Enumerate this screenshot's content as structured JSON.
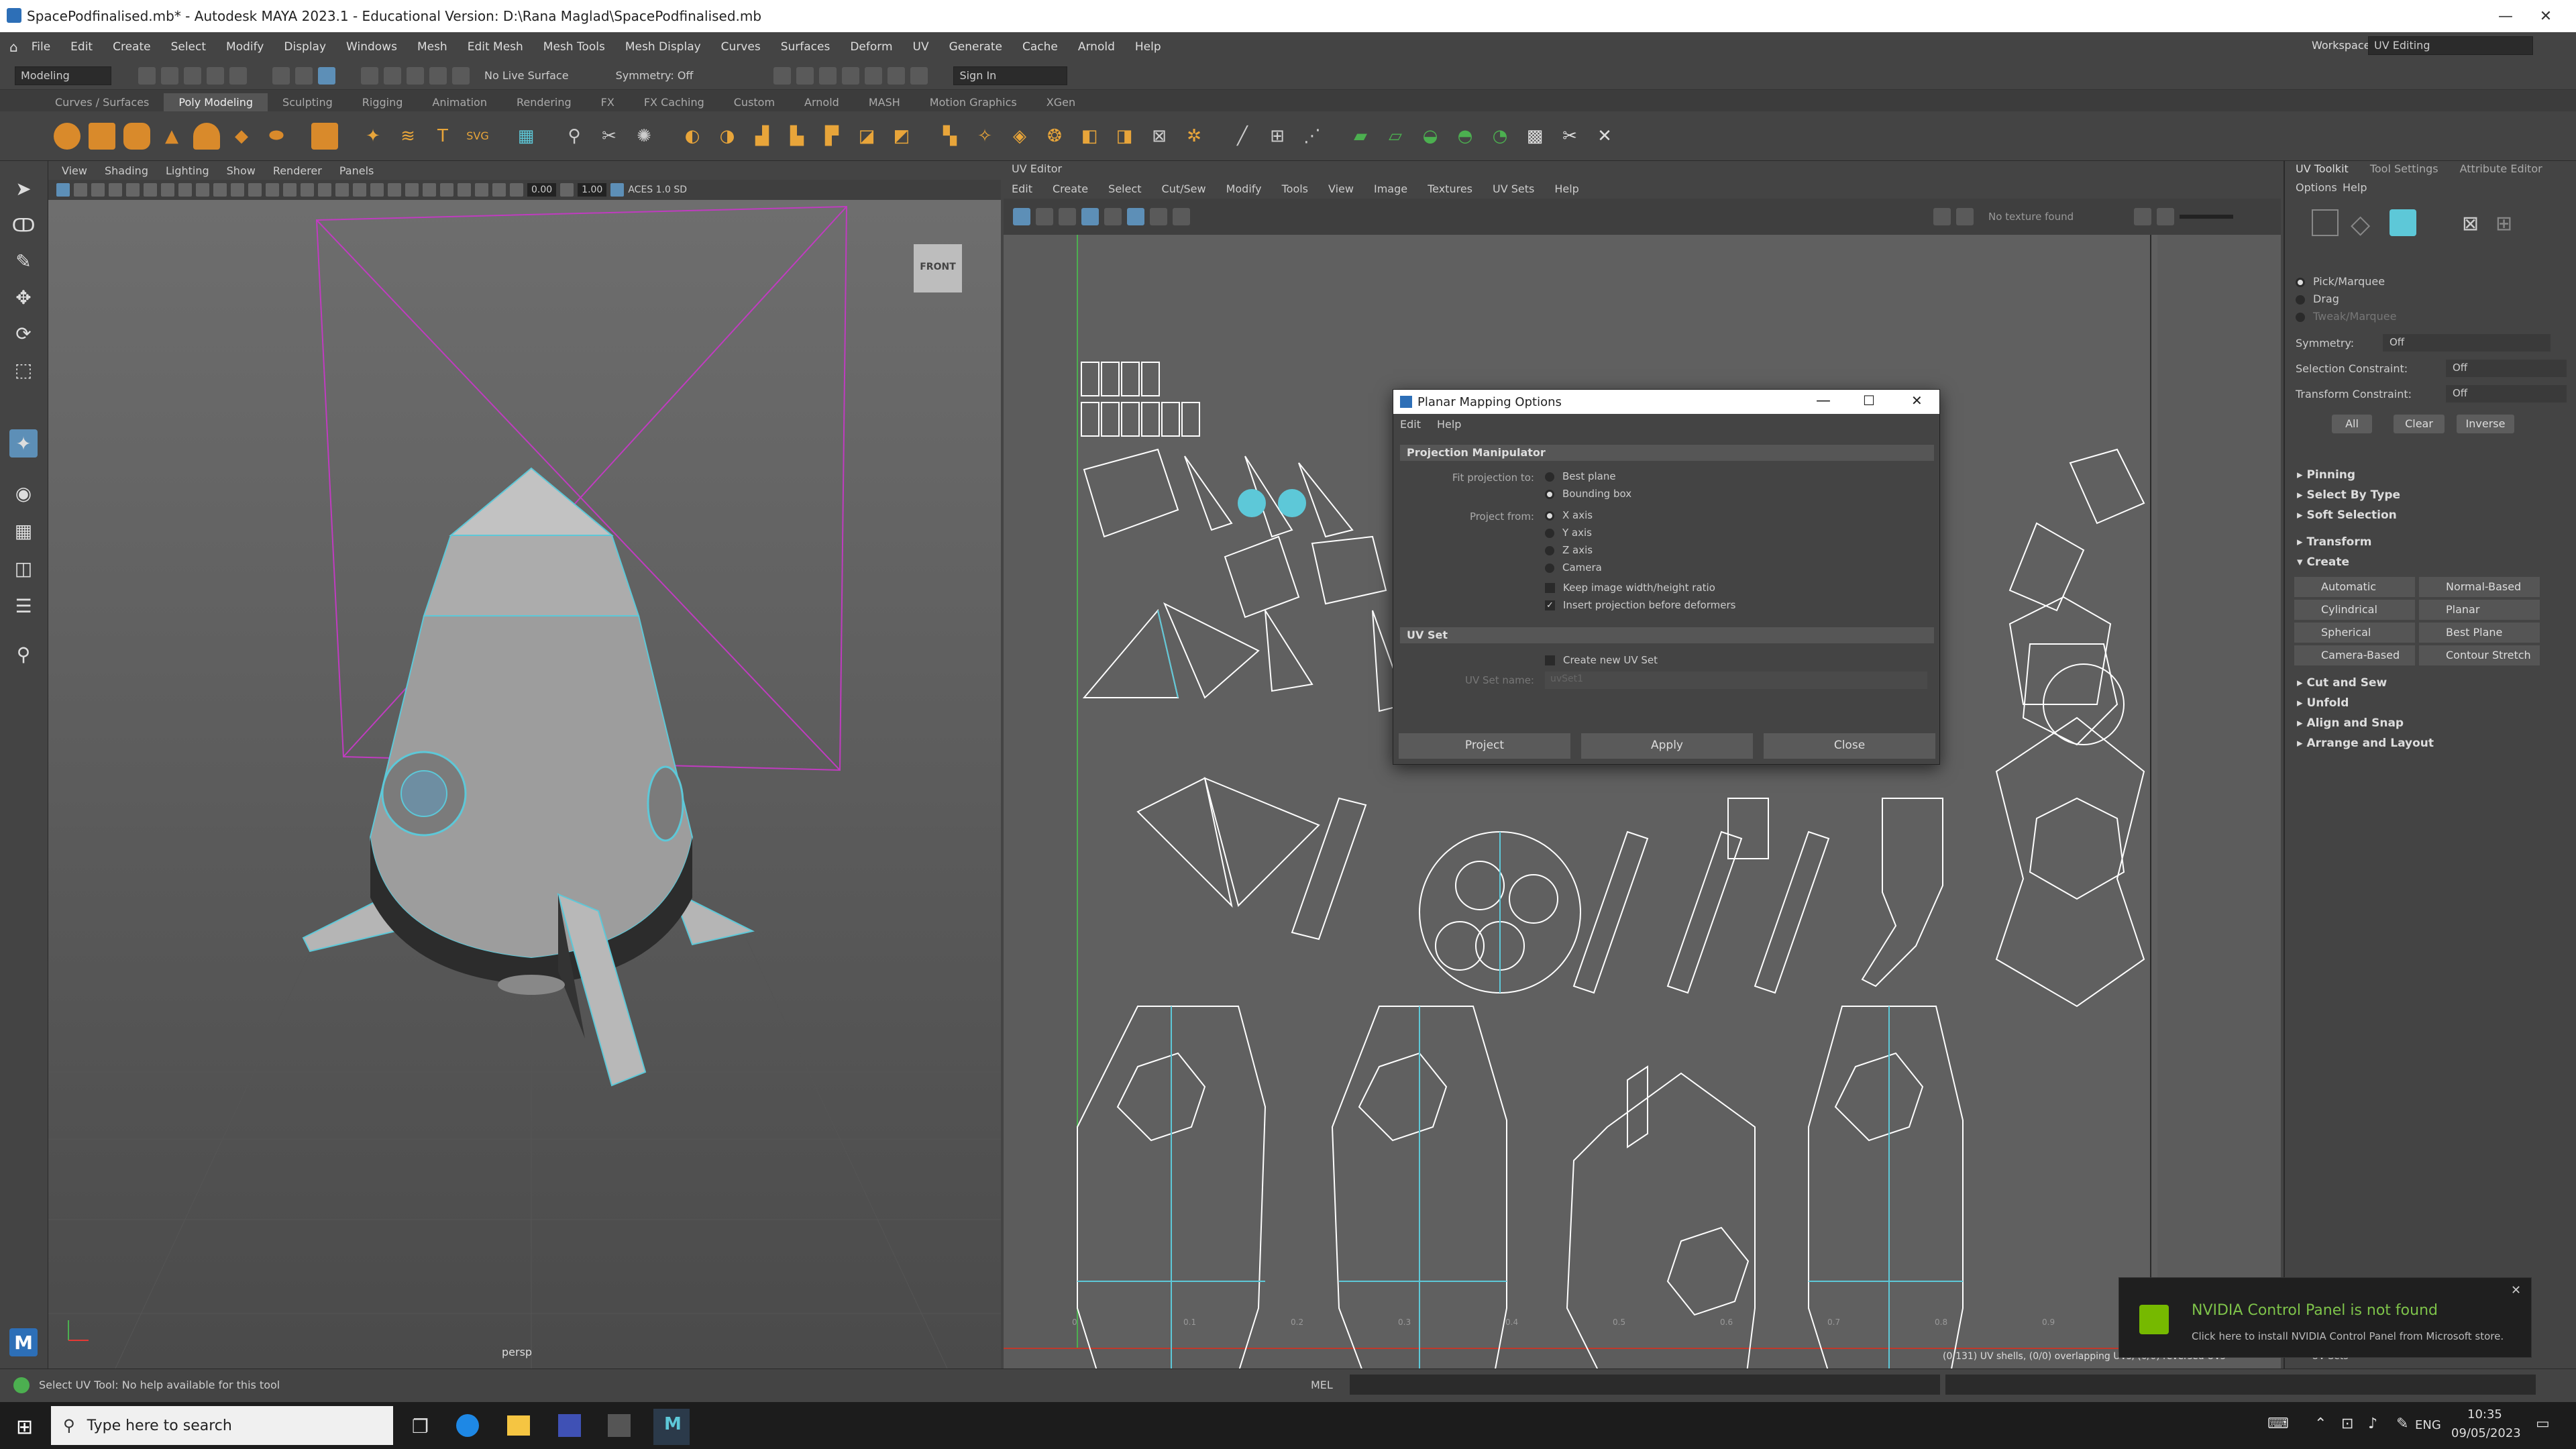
{
  "window": {
    "title": "SpacePodfinalised.mb* - Autodesk MAYA 2023.1 - Educational Version: D:\\Rana Maglad\\SpacePodfinalised.mb"
  },
  "menubar": [
    "File",
    "Edit",
    "Create",
    "Select",
    "Modify",
    "Display",
    "Windows",
    "Mesh",
    "Edit Mesh",
    "Mesh Tools",
    "Mesh Display",
    "Curves",
    "Surfaces",
    "Deform",
    "UV",
    "Generate",
    "Cache",
    "Arnold",
    "Help"
  ],
  "workspace": {
    "label": "Workspace:",
    "value": "UV Editing"
  },
  "statusline": {
    "mode": "Modeling",
    "live_surface": "No Live Surface",
    "symmetry": "Symmetry: Off",
    "signin": "Sign In"
  },
  "shelf_tabs": [
    "Curves / Surfaces",
    "Poly Modeling",
    "Sculpting",
    "Rigging",
    "Animation",
    "Rendering",
    "FX",
    "FX Caching",
    "Custom",
    "Arnold",
    "MASH",
    "Motion Graphics",
    "XGen"
  ],
  "viewport": {
    "menu": [
      "View",
      "Shading",
      "Lighting",
      "Show",
      "Renderer",
      "Panels"
    ],
    "field_a": "0.00",
    "field_b": "1.00",
    "colorspace": "ACES 1.0 SD",
    "camera_label": "persp",
    "viewcube": "FRONT"
  },
  "uv_editor": {
    "tab": "UV Editor",
    "menu": [
      "Edit",
      "Create",
      "Select",
      "Cut/Sew",
      "Modify",
      "Tools",
      "View",
      "Image",
      "Textures",
      "UV Sets",
      "Help"
    ],
    "no_texture": "No texture found",
    "status": "(0/131) UV shells, (0/0) overlapping UVs, (0/0) reversed UVs",
    "ticks": [
      "0.1",
      "0.2",
      "0.3",
      "0.4",
      "0.5",
      "0.6",
      "0.7",
      "0.8",
      "0.9"
    ]
  },
  "right_panel": {
    "tabs": [
      "UV Toolkit",
      "Tool Settings",
      "Attribute Editor"
    ],
    "menu": [
      "Options",
      "Help"
    ],
    "pick_modes": [
      "Pick/Marquee",
      "Drag",
      "Tweak/Marquee"
    ],
    "symmetry": {
      "label": "Symmetry:",
      "value": "Off"
    },
    "selection_constraint": {
      "label": "Selection Constraint:",
      "value": "Off"
    },
    "transform_constraint": {
      "label": "Transform Constraint:",
      "value": "Off"
    },
    "buttons": [
      "All",
      "Clear",
      "Inverse"
    ],
    "sections_top": [
      "Pinning",
      "Select By Type",
      "Soft Selection",
      "Transform",
      "Create"
    ],
    "create_buttons": [
      "Automatic",
      "Normal-Based",
      "Cylindrical",
      "Planar",
      "Spherical",
      "Best Plane",
      "Camera-Based",
      "Contour Stretch"
    ],
    "sections_bottom": [
      "Cut and Sew",
      "Unfold",
      "Align and Snap",
      "Arrange and Layout"
    ],
    "uv_sets_footer": "UV Sets"
  },
  "dialog": {
    "title": "Planar Mapping Options",
    "menu": [
      "Edit",
      "Help"
    ],
    "group1": "Projection Manipulator",
    "fit_label": "Fit projection to:",
    "fit_options": [
      "Best plane",
      "Bounding box"
    ],
    "from_label": "Project from:",
    "from_options": [
      "X axis",
      "Y axis",
      "Z axis",
      "Camera"
    ],
    "keep_ratio": "Keep image width/height ratio",
    "insert_before": "Insert projection before deformers",
    "group2": "UV Set",
    "create_new_set": "Create new UV Set",
    "set_name_label": "UV Set name:",
    "set_name_value": "uvSet1",
    "buttons": [
      "Project",
      "Apply",
      "Close"
    ]
  },
  "helpline": {
    "text": "Select UV Tool: No help available for this tool",
    "mel": "MEL"
  },
  "toast": {
    "title": "NVIDIA Control Panel is not found",
    "body": "Click here to install NVIDIA Control Panel from Microsoft store."
  },
  "taskbar": {
    "search_placeholder": "Type here to search",
    "lang": "ENG",
    "time": "10:35",
    "date": "09/05/2023"
  },
  "colors": {
    "accent": "#5dc8d8",
    "dialog_header": "#ffffff",
    "uv_lines": "#ffffff",
    "toast_title": "#7ec34a"
  }
}
